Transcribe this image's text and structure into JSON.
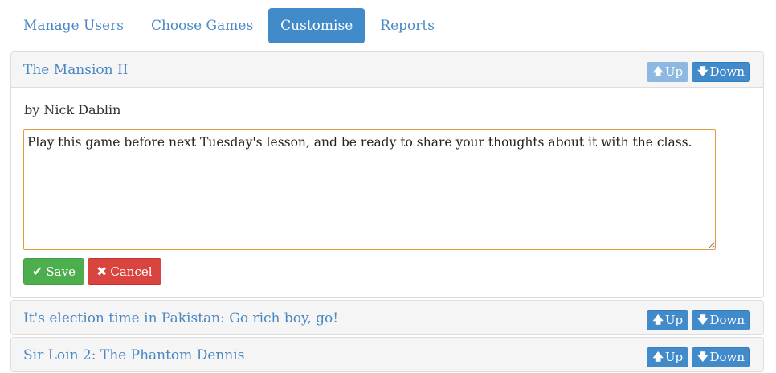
{
  "tabs": [
    {
      "label": "Manage Users"
    },
    {
      "label": "Choose Games"
    },
    {
      "label": "Customise"
    },
    {
      "label": "Reports"
    }
  ],
  "active_tab": "Customise",
  "games": [
    {
      "title": "The Mansion II",
      "author": "by Nick Dablin",
      "note": "Play this game before next Tuesday's lesson, and be ready to share your thoughts about it with the class.",
      "up_label": "Up",
      "down_label": "Down"
    },
    {
      "title": "It's election time in Pakistan: Go rich boy, go!",
      "up_label": "Up",
      "down_label": "Down"
    },
    {
      "title": "Sir Loin 2: The Phantom Dennis",
      "up_label": "Up",
      "down_label": "Down"
    }
  ],
  "editor": {
    "save_label": "Save",
    "cancel_label": "Cancel"
  },
  "icons": {
    "up": "arrow-up-icon",
    "down": "arrow-down-icon",
    "save": "check-icon",
    "cancel": "x-icon"
  },
  "colors": {
    "primary": "#428bca",
    "link": "#4a88c4",
    "success": "#4cae4c",
    "danger": "#d9443f",
    "focus_border": "#e29b3c"
  }
}
